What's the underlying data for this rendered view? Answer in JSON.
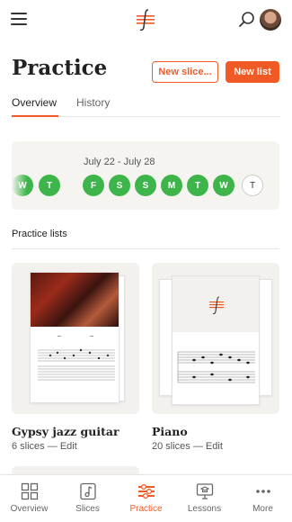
{
  "header": {
    "menu_icon": "hamburger-icon",
    "logo_icon": "app-logo",
    "search_icon": "search-icon",
    "avatar": "user-avatar"
  },
  "page": {
    "title": "Practice",
    "new_slice_label": "New slice...",
    "new_list_label": "New list"
  },
  "tabs": [
    {
      "label": "Overview",
      "active": true
    },
    {
      "label": "History",
      "active": false
    }
  ],
  "week": {
    "range": "July 22 - July 28",
    "days": [
      {
        "label": "W",
        "practiced": true
      },
      {
        "label": "T",
        "practiced": true
      },
      {
        "label": "F",
        "practiced": true
      },
      {
        "label": "S",
        "practiced": true
      },
      {
        "label": "S",
        "practiced": true
      },
      {
        "label": "M",
        "practiced": true
      },
      {
        "label": "T",
        "practiced": true
      },
      {
        "label": "W",
        "practiced": true
      },
      {
        "label": "T",
        "practiced": false
      }
    ]
  },
  "practice_lists": {
    "title": "Practice lists",
    "items": [
      {
        "name": "Gypsy jazz guitar",
        "slices": "6 slices",
        "separator": " — ",
        "edit": "Edit"
      },
      {
        "name": "Piano",
        "slices": "20 slices",
        "separator": " — ",
        "edit": "Edit"
      }
    ]
  },
  "tabbar": [
    {
      "label": "Overview",
      "icon": "grid-icon",
      "active": false
    },
    {
      "label": "Slices",
      "icon": "music-note-icon",
      "active": false
    },
    {
      "label": "Practice",
      "icon": "practice-icon",
      "active": true
    },
    {
      "label": "Lessons",
      "icon": "lessons-icon",
      "active": false
    },
    {
      "label": "More",
      "icon": "more-dots-icon",
      "active": false
    }
  ],
  "colors": {
    "accent": "#f15a24",
    "success": "#3db54a",
    "card_bg": "#f2f1ee"
  }
}
